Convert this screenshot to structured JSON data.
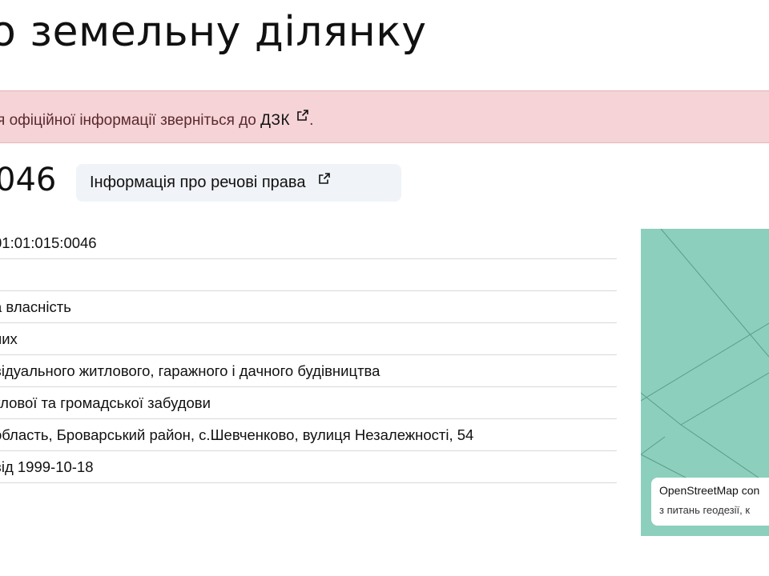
{
  "header": {
    "title": "о земельну ділянку"
  },
  "alert": {
    "text_before": "я офіційної інформації зверніться до ",
    "link_label": "ДЗК",
    "text_after": "."
  },
  "parcel": {
    "heading": "046",
    "rights_button_label": "Інформація про речові права"
  },
  "details": [
    {
      "value": "01:01:015:0046"
    },
    {
      "value": ""
    },
    {
      "value": "а власність"
    },
    {
      "value": "них"
    },
    {
      "value": "відуального житлового, гаражного і дачного будівництва"
    },
    {
      "value": "тлової та громадської забудови"
    },
    {
      "value": "область, Броварський район, с.Шевченково, вулиця Незалежності, 54"
    },
    {
      "value": "від 1999-10-18"
    }
  ],
  "map": {
    "attribution": "OpenStreetMap con",
    "geodesy_note": "з питань геодезії, к",
    "background_color": "#8ccfbc"
  },
  "icons": {
    "external_link": "external-link-icon"
  }
}
